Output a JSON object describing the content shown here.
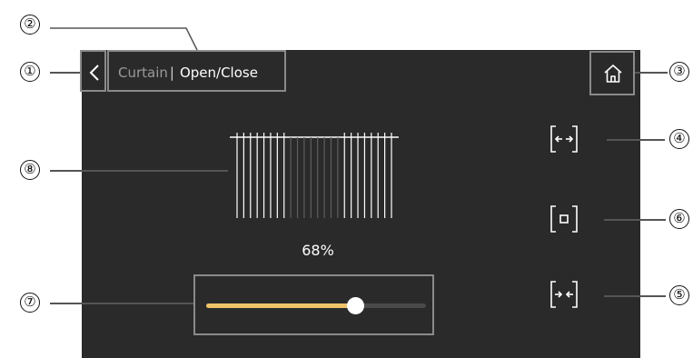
{
  "header": {
    "breadcrumb_parent": "Curtain",
    "breadcrumb_separator": "|",
    "breadcrumb_current": "Open/Close"
  },
  "curtain": {
    "position_label": "68%",
    "position_value": 0.68
  },
  "icons": {
    "back": "chevron-left-icon",
    "home": "home-icon",
    "open": "curtain-open-icon",
    "stop": "curtain-stop-icon",
    "close": "curtain-close-icon"
  },
  "callouts": {
    "c1": "①",
    "c2": "②",
    "c3": "③",
    "c4": "④",
    "c5": "⑤",
    "c6": "⑥",
    "c7": "⑦",
    "c8": "⑧"
  },
  "colors": {
    "screen_bg": "#2a2a2a",
    "slider_fill": "#f0c36a",
    "frame": "#8a8a8a"
  }
}
